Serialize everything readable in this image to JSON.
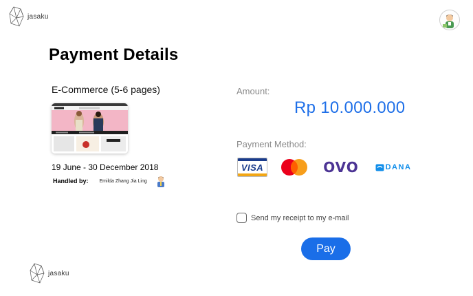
{
  "brand": {
    "logo_text": "jasaku",
    "icon": "geometric-crystal-logo-icon"
  },
  "user": {
    "avatar_icon": "user-avatar-icon"
  },
  "page": {
    "title": "Payment Details"
  },
  "project": {
    "name": "E-Commerce (5-6 pages)",
    "thumbnail_icon": "ecommerce-website-thumbnail",
    "date_range": "19 June - 30 December 2018",
    "handled_by_label": "Handled by:",
    "handler_name": "Emilda Zhang Jia Ling",
    "handler_icon": "handler-avatar-icon"
  },
  "payment": {
    "amount_label": "Amount:",
    "amount_value": "Rp 10.000.000",
    "method_label": "Payment Method:",
    "methods": [
      {
        "name": "visa",
        "label": "VISA"
      },
      {
        "name": "mastercard",
        "label": ""
      },
      {
        "name": "ovo",
        "label": "OVO"
      },
      {
        "name": "dana",
        "label": "DANA"
      }
    ],
    "receipt_label": "Send my receipt to my e-mail",
    "receipt_checked": false,
    "pay_label": "Pay"
  },
  "colors": {
    "accent_blue": "#1e6fe8",
    "label_gray": "#8a8a8a",
    "ovo_purple": "#4c3494",
    "dana_blue": "#118eea",
    "mc_red": "#eb001b",
    "mc_orange": "#f79e1b"
  }
}
